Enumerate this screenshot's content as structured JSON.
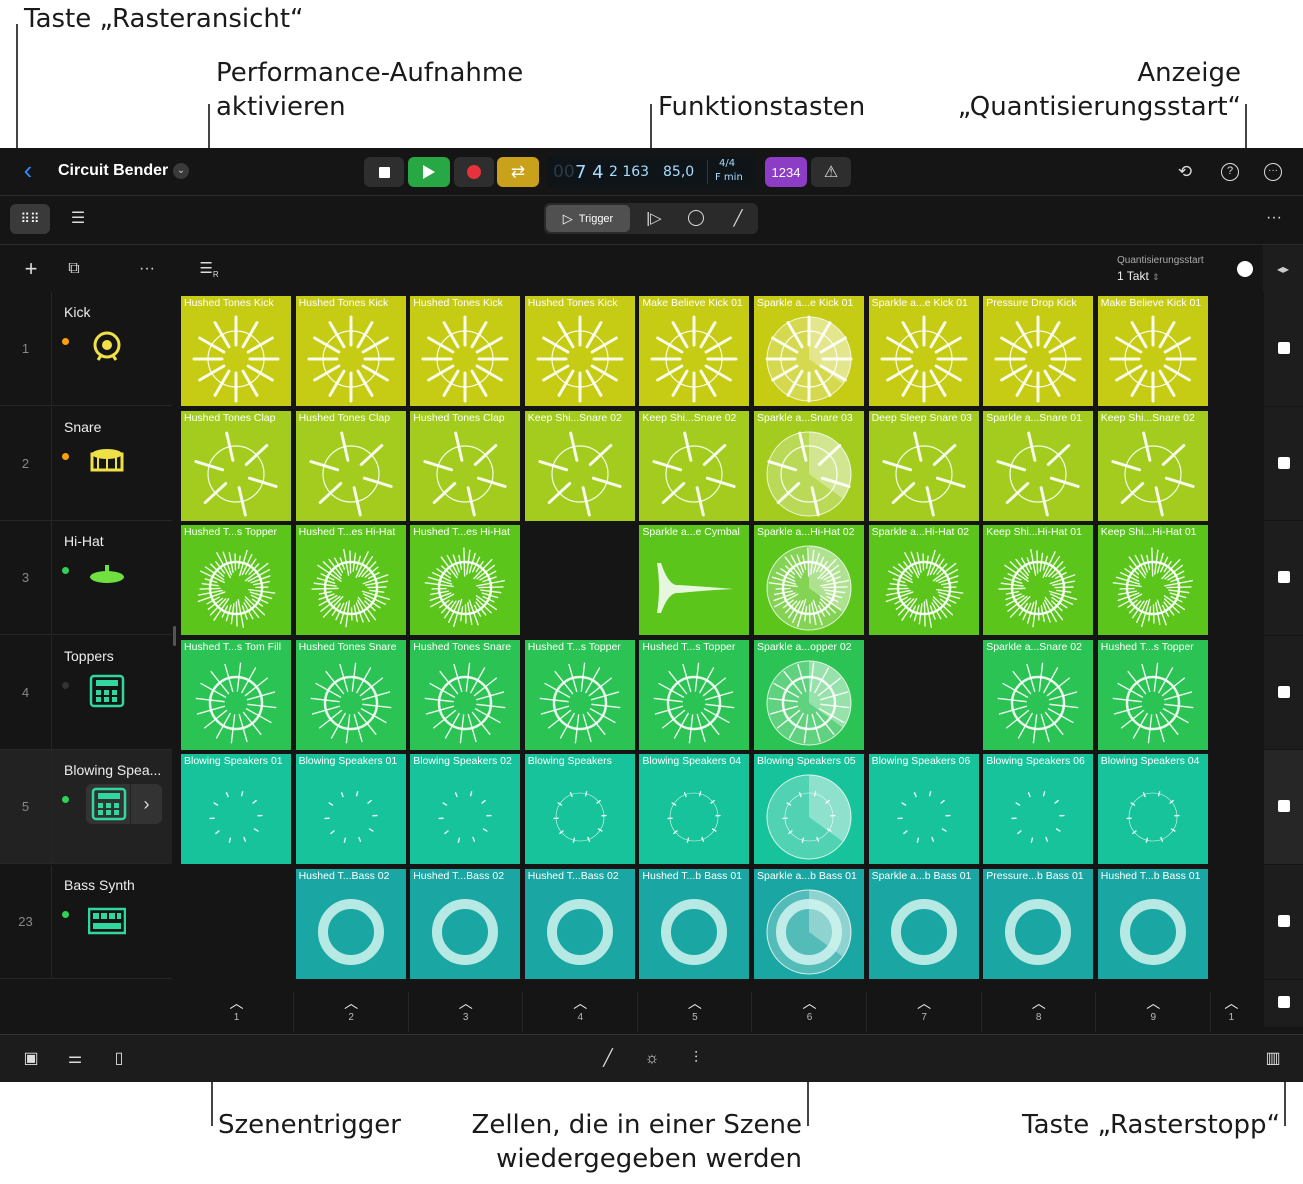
{
  "callouts": {
    "grid_view": "Taste „Rasteransicht“",
    "performance_line1": "Performance-Aufnahme",
    "performance_line2": "aktivieren",
    "function_keys": "Funktionstasten",
    "quant_line1": "Anzeige",
    "quant_line2": "„Quantisierungsstart“",
    "scene_trigger": "Szenentrigger",
    "cells_line1": "Zellen, die in einer Szene",
    "cells_line2": "wiedergegeben werden",
    "grid_stop": "Taste „Rasterstopp“"
  },
  "header": {
    "project_title": "Circuit Bender",
    "lcd_bar": "7 4",
    "lcd_beat": "2 163",
    "lcd_faded": "00",
    "tempo": "85,0",
    "signature": "4/4",
    "key": "F min",
    "count_in": "1234"
  },
  "play_modes": {
    "trigger": "Trigger"
  },
  "quantize": {
    "label": "Quantisierungsstart",
    "value": "1 Takt"
  },
  "colors": {
    "row1": "#c6cc14",
    "row2": "#a3cc1f",
    "row3": "#5bc51c",
    "row4": "#2bc354",
    "row5": "#17c39a",
    "row6": "#1aa6a2",
    "play_green": "#28a745",
    "record_red": "#e5323b",
    "cycle_yellow": "#c9a11a",
    "countin_purple": "#8d3cc6"
  },
  "tracks": [
    {
      "num": "1",
      "name": "Kick",
      "dot": "#ff9f0a",
      "icon": "kick-drum-icon"
    },
    {
      "num": "2",
      "name": "Snare",
      "dot": "#ff9f0a",
      "icon": "snare-drum-icon"
    },
    {
      "num": "3",
      "name": "Hi-Hat",
      "dot": "#30d158",
      "icon": "hihat-icon"
    },
    {
      "num": "4",
      "name": "Toppers",
      "dot": "#333333",
      "icon": "drum-machine-icon"
    },
    {
      "num": "5",
      "name": "Blowing Spea...",
      "dot": "#30d158",
      "icon": "drum-machine-icon"
    },
    {
      "num": "23",
      "name": "Bass Synth",
      "dot": "#30d158",
      "icon": "synth-icon"
    }
  ],
  "cells": [
    [
      "Hushed Tones Kick",
      "Hushed Tones Kick",
      "Hushed Tones Kick",
      "Hushed Tones Kick",
      "Make Believe Kick 01",
      "Sparkle a...e Kick 01",
      "Sparkle a...e Kick 01",
      "Pressure Drop Kick",
      "Make Believe Kick 01"
    ],
    [
      "Hushed Tones Clap",
      "Hushed Tones Clap",
      "Hushed Tones Clap",
      "Keep Shi...Snare 02",
      "Keep Shi...Snare 02",
      "Sparkle a...Snare 03",
      "Deep Sleep Snare 03",
      "Sparkle a...Snare 01",
      "Keep Shi...Snare 02"
    ],
    [
      "Hushed T...s Topper",
      "Hushed T...es Hi-Hat",
      "Hushed T...es Hi-Hat",
      "",
      "Sparkle a...e Cymbal",
      "Sparkle a...Hi-Hat 02",
      "Sparkle a...Hi-Hat 02",
      "Keep Shi...Hi-Hat 01",
      "Keep Shi...Hi-Hat 01"
    ],
    [
      "Hushed T...s Tom Fill",
      "Hushed Tones Snare",
      "Hushed Tones Snare",
      "Hushed T...s Topper",
      "Hushed T...s Topper",
      "Sparkle a...opper 02",
      "",
      "Sparkle a...Snare 02",
      "Hushed T...s Topper"
    ],
    [
      "Blowing Speakers 01",
      "Blowing Speakers 01",
      "Blowing Speakers 02",
      "Blowing Speakers",
      "Blowing Speakers 04",
      "Blowing Speakers 05",
      "Blowing Speakers 06",
      "Blowing Speakers 06",
      "Blowing Speakers 04"
    ],
    [
      "",
      "Hushed T...Bass 02",
      "Hushed T...Bass 02",
      "Hushed T...Bass 02",
      "Hushed T...b Bass 01",
      "Sparkle a...b Bass 01",
      "Sparkle a...b Bass 01",
      "Pressure...b Bass 01",
      "Hushed T...b Bass 01"
    ]
  ],
  "scenes": [
    "1",
    "2",
    "3",
    "4",
    "5",
    "6",
    "7",
    "8",
    "9",
    "1"
  ]
}
